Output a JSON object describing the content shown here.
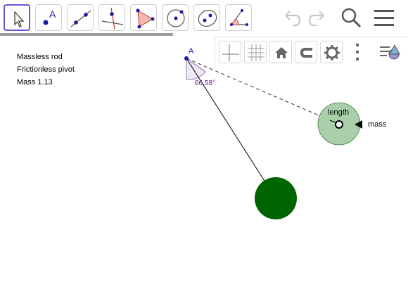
{
  "toolbar": {
    "tools": [
      {
        "name": "move-tool",
        "icon": "arrow-cursor-icon",
        "selected": true
      },
      {
        "name": "point-tool",
        "icon": "point-icon",
        "label": "A"
      },
      {
        "name": "line-tool",
        "icon": "line-through-two-points-icon"
      },
      {
        "name": "perpendicular-line-tool",
        "icon": "perpendicular-line-icon"
      },
      {
        "name": "polygon-tool",
        "icon": "polygon-icon"
      },
      {
        "name": "circle-tool",
        "icon": "circle-with-center-icon"
      },
      {
        "name": "ellipse-tool",
        "icon": "ellipse-icon"
      },
      {
        "name": "angle-tool",
        "icon": "angle-icon"
      }
    ],
    "point_tool_label": "A",
    "actions": [
      "undo-icon",
      "redo-icon",
      "search-icon",
      "menu-icon"
    ]
  },
  "style_bar": {
    "buttons": [
      "axes-icon",
      "grid-icon",
      "home-icon",
      "magnet-icon",
      "gear-icon",
      "more-vertical-icon",
      "style-bar-toggle-icon"
    ]
  },
  "info": {
    "line1": "Massless rod",
    "line2": "Frictionless pivot",
    "line3": "Mass 1.13"
  },
  "construction": {
    "pivot_label": "A",
    "angle_label": "66.58°",
    "slider_length_label": "length",
    "slider_mass_label": "mass",
    "colors": {
      "bob": "#006400",
      "slider_disc": "#a8cfa8",
      "angle_fill": "#eee8f7",
      "angle_text": "#6a1b8a",
      "point": "#1a1aa6",
      "selected_tool": "#6557d2"
    }
  }
}
